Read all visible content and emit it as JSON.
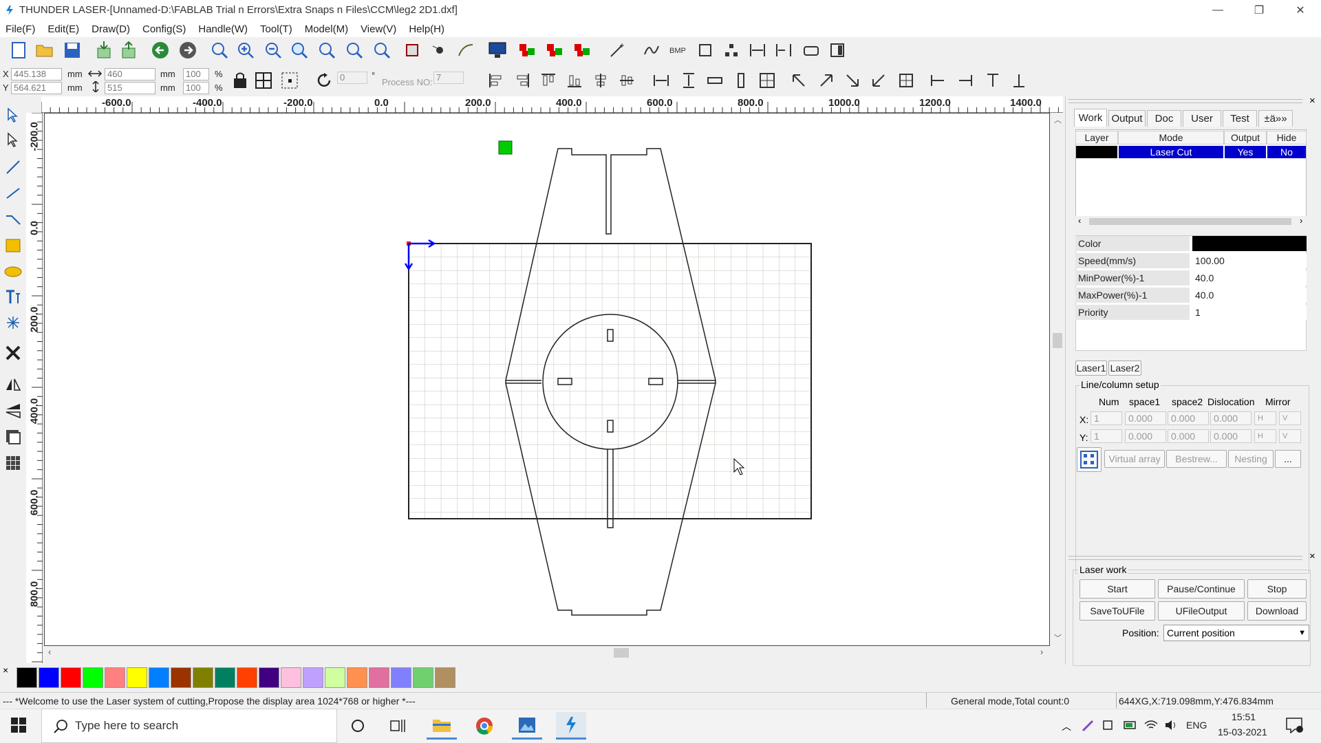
{
  "window": {
    "title": "THUNDER LASER-[Unnamed-D:\\FABLAB Trial n Errors\\Extra Snaps n Files\\CCM\\leg2 2D1.dxf]",
    "minimize_glyph": "—",
    "restore_glyph": "❐",
    "close_glyph": "✕"
  },
  "menu": [
    "File(F)",
    "Edit(E)",
    "Draw(D)",
    "Config(S)",
    "Handle(W)",
    "Tool(T)",
    "Model(M)",
    "View(V)",
    "Help(H)"
  ],
  "coords": {
    "x_label": "X",
    "y_label": "Y",
    "x_value": "445.138",
    "y_value": "564.621",
    "unit": "mm",
    "width_value": "460",
    "height_value": "515",
    "scale_w": "100",
    "scale_h": "100",
    "percent": "%",
    "rotation": "0",
    "degree": "°",
    "process_label": "Process NO:",
    "process_value": "7"
  },
  "ruler": {
    "horizontal": [
      "-600.0",
      "-400.0",
      "-200.0",
      "0.0",
      "200.0",
      "400.0",
      "600.0",
      "800.0",
      "1000.0",
      "1200.0",
      "1400.0"
    ],
    "vertical": [
      "-200.0",
      "0.0",
      "200.0",
      "400.0",
      "600.0",
      "800.0"
    ]
  },
  "palette": {
    "close_glyph": "×",
    "colors": [
      "#000000",
      "#0000ff",
      "#ff0000",
      "#00ff00",
      "#ff8080",
      "#ffff00",
      "#0080ff",
      "#993300",
      "#808000",
      "#008060",
      "#ff4000",
      "#400080",
      "#ffc0e0",
      "#c0a0ff",
      "#d0ffa0",
      "#ff9050",
      "#e070a0",
      "#8080ff",
      "#70d070",
      "#b09060"
    ]
  },
  "status": {
    "message": "--- *Welcome to use the Laser system of cutting,Propose the display area 1024*768 or higher *---",
    "mode": "General mode,Total count:0",
    "position": "644XG,X:719.098mm,Y:476.834mm"
  },
  "panel": {
    "tabs": [
      "Work",
      "Output",
      "Doc",
      "User",
      "Test",
      "±ä»»"
    ],
    "active_tab": "Work",
    "layer_headers": [
      "Layer",
      "Mode",
      "Output",
      "Hide"
    ],
    "layer_row": {
      "color": "#000000",
      "mode": "Laser Cut",
      "output": "Yes",
      "hide": "No"
    },
    "properties": [
      {
        "label": "Color",
        "value": ""
      },
      {
        "label": "Speed(mm/s)",
        "value": "100.00"
      },
      {
        "label": "MinPower(%)-1",
        "value": "40.0"
      },
      {
        "label": "MaxPower(%)-1",
        "value": "40.0"
      },
      {
        "label": "Priority",
        "value": "1"
      }
    ],
    "laser_tabs": [
      "Laser1",
      "Laser2"
    ],
    "line_setup": {
      "title": "Line/column setup",
      "headers": [
        "Num",
        "space1",
        "space2",
        "Dislocation",
        "Mirror"
      ],
      "x_label": "X:",
      "y_label": "Y:",
      "x_values": [
        "1",
        "0.000",
        "0.000",
        "0.000"
      ],
      "y_values": [
        "1",
        "0.000",
        "0.000",
        "0.000"
      ],
      "mirror_h": "H",
      "mirror_v": "V"
    },
    "array_buttons": [
      "Virtual array",
      "Bestrew...",
      "Nesting",
      "..."
    ],
    "laser_work": {
      "title": "Laser work",
      "buttons": [
        "Start",
        "Pause/Continue",
        "Stop",
        "SaveToUFile",
        "UFileOutput",
        "Download"
      ],
      "position_label": "Position:",
      "position_value": "Current position"
    },
    "close_glyph": "×"
  },
  "taskbar": {
    "search_placeholder": "Type here to search",
    "lang": "ENG",
    "time": "15:51",
    "date": "15-03-2021"
  }
}
